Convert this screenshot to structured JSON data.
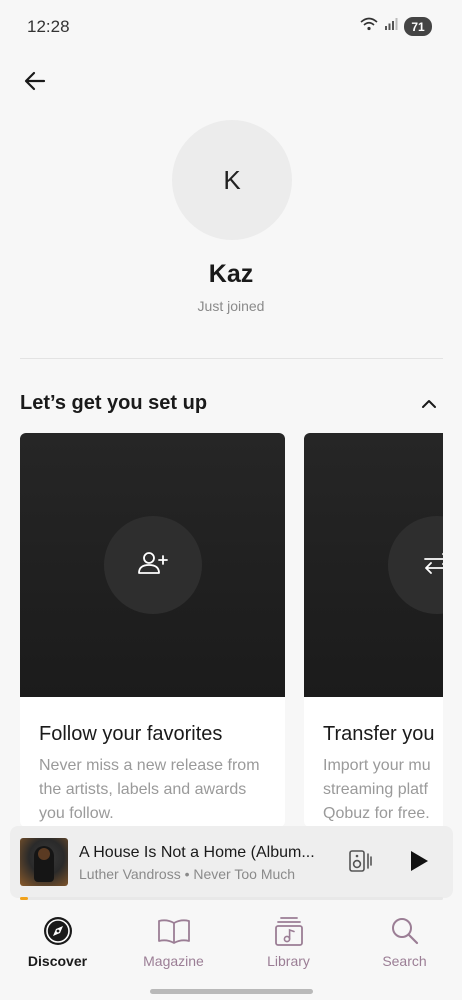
{
  "status_bar": {
    "time": "12:28",
    "battery": "71",
    "icons": [
      "wifi-icon",
      "signal-icon",
      "battery-icon"
    ]
  },
  "profile": {
    "initial": "K",
    "name": "Kaz",
    "status": "Just joined"
  },
  "setup": {
    "title": "Let’s get you set up",
    "cards": [
      {
        "icon": "add-user-icon",
        "title": "Follow your favorites",
        "description": "Never miss a new release from the artists, labels and awards you follow."
      },
      {
        "icon": "transfer-icon",
        "title": "Transfer you",
        "description_lines": [
          "Import your mu",
          "streaming platf",
          "Qobuz for free."
        ]
      }
    ]
  },
  "now_playing": {
    "title": "A House Is Not a Home (Album...",
    "subtitle": "Luther Vandross • Never Too Much",
    "progress": 0.02
  },
  "nav": {
    "items": [
      {
        "label": "Discover",
        "icon": "compass-icon",
        "active": true
      },
      {
        "label": "Magazine",
        "icon": "book-icon",
        "active": false
      },
      {
        "label": "Library",
        "icon": "library-icon",
        "active": false
      },
      {
        "label": "Search",
        "icon": "search-icon",
        "active": false
      }
    ]
  },
  "colors": {
    "accent_progress": "#f1a21b",
    "nav_inactive": "#9b7e95",
    "background": "#f7f7f7",
    "card_dark": "#1f1f1f"
  }
}
